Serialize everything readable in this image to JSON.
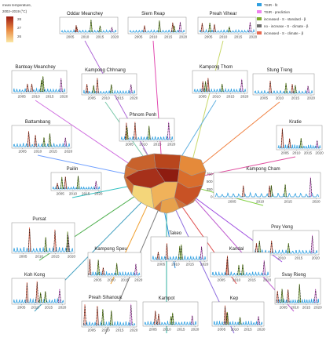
{
  "colorbar": {
    "title_line1": "mean temperature,",
    "title_line2": "2002–2019 (°C)",
    "ticks": [
      "28",
      "27",
      "26"
    ],
    "low_color": "#fbe7a3",
    "mid_color": "#e8863f",
    "high_color": "#9c1a12"
  },
  "legend": {
    "items": [
      {
        "label": "TSIR - fit",
        "color": "#2f9fe0"
      },
      {
        "label": "TSIR - prediction",
        "color": "#ee82ee"
      },
      {
        "label": "increased - S - standard - β",
        "color": "#7dab2f"
      },
      {
        "label": "no - increase - S - climate - β",
        "color": "#6e6e6e"
      },
      {
        "label": "increased - S - climate - β",
        "color": "#e7684f"
      }
    ]
  },
  "observed_style": "black-dashed",
  "chart_data": [
    {
      "type": "line",
      "title": "Oddar Meanchey",
      "x_ticks": [
        "2005",
        "2010",
        "2015",
        "2020"
      ],
      "y_ticks": [
        "",
        "",
        "",
        ""
      ],
      "notes": "seasonal dengue incidence time series with large epidemic peaks"
    },
    {
      "type": "line",
      "title": "Siem Reap",
      "x_ticks": [
        "2005",
        "2010",
        "2015",
        "2020"
      ],
      "y_ticks": [
        "",
        "",
        "",
        ""
      ]
    },
    {
      "type": "line",
      "title": "Preah Vihear",
      "x_ticks": [
        "2005",
        "2010",
        "2015",
        "2020"
      ],
      "y_ticks": [
        "",
        "",
        "",
        ""
      ]
    },
    {
      "type": "line",
      "title": "Banteay Meanchey",
      "x_ticks": [
        "2005",
        "2010",
        "2015",
        "2020"
      ],
      "y_ticks": [
        "",
        "",
        "",
        ""
      ]
    },
    {
      "type": "line",
      "title": "Kampong Chhnang",
      "x_ticks": [
        "2005",
        "2010",
        "2015",
        "2020"
      ],
      "y_ticks": [
        "",
        "",
        "",
        ""
      ]
    },
    {
      "type": "line",
      "title": "Kampong Thom",
      "x_ticks": [
        "2005",
        "2010",
        "2015",
        "2020"
      ],
      "y_ticks": [
        "",
        "",
        "",
        ""
      ]
    },
    {
      "type": "line",
      "title": "Stung Treng",
      "x_ticks": [
        "2005",
        "2010",
        "2015",
        "2020"
      ],
      "y_ticks": [
        "",
        "",
        "",
        ""
      ]
    },
    {
      "type": "line",
      "title": "Phnom Penh",
      "x_ticks": [
        "2005",
        "2010",
        "2015",
        "2020"
      ],
      "y_ticks": [
        "",
        "",
        "",
        ""
      ]
    },
    {
      "type": "line",
      "title": "Battambang",
      "x_ticks": [
        "2005",
        "2010",
        "2015",
        "2020"
      ],
      "y_ticks": [
        "",
        "",
        "",
        ""
      ]
    },
    {
      "type": "line",
      "title": "Kratie",
      "x_ticks": [
        "2005",
        "2010",
        "2015",
        "2020"
      ],
      "y_ticks": [
        "",
        "",
        "",
        ""
      ]
    },
    {
      "type": "line",
      "title": "Pailin",
      "x_ticks": [
        "2005",
        "2010",
        "2015",
        "2020"
      ],
      "y_ticks": [
        "",
        "",
        "",
        ""
      ]
    },
    {
      "type": "line",
      "title": "Kampong Cham",
      "x_ticks": [
        "2005",
        "2010",
        "2015",
        "2020"
      ],
      "y_ticks": [
        "750",
        "500",
        "250",
        "0"
      ]
    },
    {
      "type": "line",
      "title": "Pursat",
      "x_ticks": [
        "2005",
        "2010",
        "2015",
        "2020"
      ],
      "y_ticks": [
        "",
        "",
        "",
        ""
      ]
    },
    {
      "type": "line",
      "title": "Prey Veng",
      "x_ticks": [
        "2005",
        "2010",
        "2015",
        "2020"
      ],
      "y_ticks": [
        "",
        "",
        "",
        ""
      ]
    },
    {
      "type": "line",
      "title": "Takeo",
      "x_ticks": [
        "2005",
        "2010",
        "2015",
        "2020"
      ],
      "y_ticks": [
        "",
        "",
        "",
        ""
      ]
    },
    {
      "type": "line",
      "title": "Kampong Speu",
      "x_ticks": [
        "2005",
        "2010",
        "2015",
        "2020"
      ],
      "y_ticks": [
        "",
        "",
        "",
        ""
      ]
    },
    {
      "type": "line",
      "title": "Kandal",
      "x_ticks": [
        "2005",
        "2010",
        "2015",
        "2020"
      ],
      "y_ticks": [
        "",
        "",
        "",
        ""
      ]
    },
    {
      "type": "line",
      "title": "Koh Kong",
      "x_ticks": [
        "2005",
        "2010",
        "2015",
        "2020"
      ],
      "y_ticks": [
        "",
        "",
        "",
        ""
      ]
    },
    {
      "type": "line",
      "title": "Svay Rieng",
      "x_ticks": [
        "2005",
        "2010",
        "2015",
        "2020"
      ],
      "y_ticks": [
        "",
        "",
        "",
        ""
      ]
    },
    {
      "type": "line",
      "title": "Preah Sihanouk",
      "x_ticks": [
        "2005",
        "2010",
        "2015",
        "2020"
      ],
      "y_ticks": [
        "",
        "",
        "",
        ""
      ]
    },
    {
      "type": "line",
      "title": "Kampot",
      "x_ticks": [
        "2005",
        "2010",
        "2015",
        "2020"
      ],
      "y_ticks": [
        "",
        "",
        "",
        ""
      ]
    },
    {
      "type": "line",
      "title": "Kep",
      "x_ticks": [
        "2005",
        "2010",
        "2015",
        "2020"
      ],
      "y_ticks": [
        "",
        "",
        "",
        ""
      ]
    }
  ]
}
